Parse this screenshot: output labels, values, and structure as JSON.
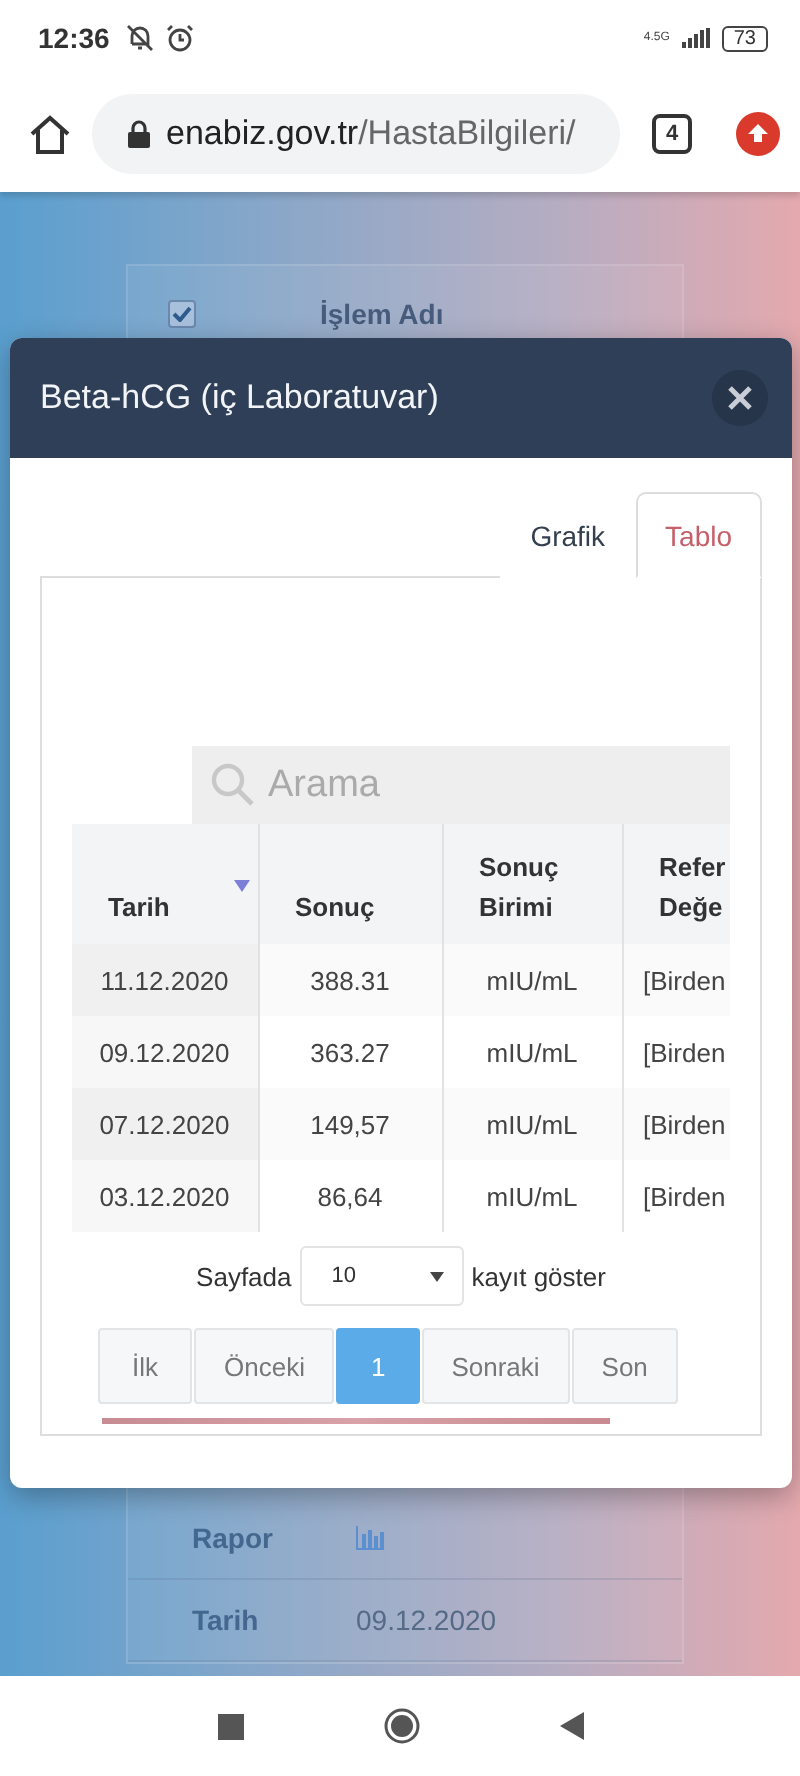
{
  "status_bar": {
    "time": "12:36",
    "network": "4.5G",
    "battery": "73"
  },
  "browser": {
    "url_host": "enabiz.gov.tr",
    "url_path": "/HastaBilgileri/",
    "tab_count": "4"
  },
  "page": {
    "column_header": "İşlem Adı",
    "header_checked": true,
    "rows": [
      {
        "label": "Rapor",
        "kind": "chart"
      },
      {
        "label": "Tarih",
        "value": "09.12.2020",
        "kind": "text"
      }
    ]
  },
  "modal": {
    "title": "Beta-hCG (iç Laboratuvar)",
    "tabs": [
      {
        "label": "Grafik",
        "selected": false
      },
      {
        "label": "Tablo",
        "selected": true
      }
    ],
    "search": {
      "placeholder": "Arama"
    },
    "table": {
      "columns": [
        {
          "label": "Tarih",
          "sorted": true
        },
        {
          "label": "Sonuç",
          "sorted": false
        },
        {
          "label": "Sonuç Birimi",
          "sorted": false
        },
        {
          "label": "Refer Değe",
          "sorted": false
        }
      ],
      "rows": [
        [
          "11.12.2020",
          "388.31",
          "mIU/mL",
          "[Birden"
        ],
        [
          "09.12.2020",
          "363.27",
          "mIU/mL",
          "[Birden"
        ],
        [
          "07.12.2020",
          "149,57",
          "mIU/mL",
          "[Birden"
        ],
        [
          "03.12.2020",
          "86,64",
          "mIU/mL",
          "[Birden"
        ]
      ]
    },
    "page_size": {
      "label_before": "Sayfada",
      "value": "10",
      "label_after": "kayıt göster"
    },
    "pagination": [
      {
        "label": "İlk",
        "selected": false
      },
      {
        "label": "Önceki",
        "selected": false
      },
      {
        "label": "1",
        "selected": true
      },
      {
        "label": "Sonraki",
        "selected": false
      },
      {
        "label": "Son",
        "selected": false
      }
    ]
  }
}
